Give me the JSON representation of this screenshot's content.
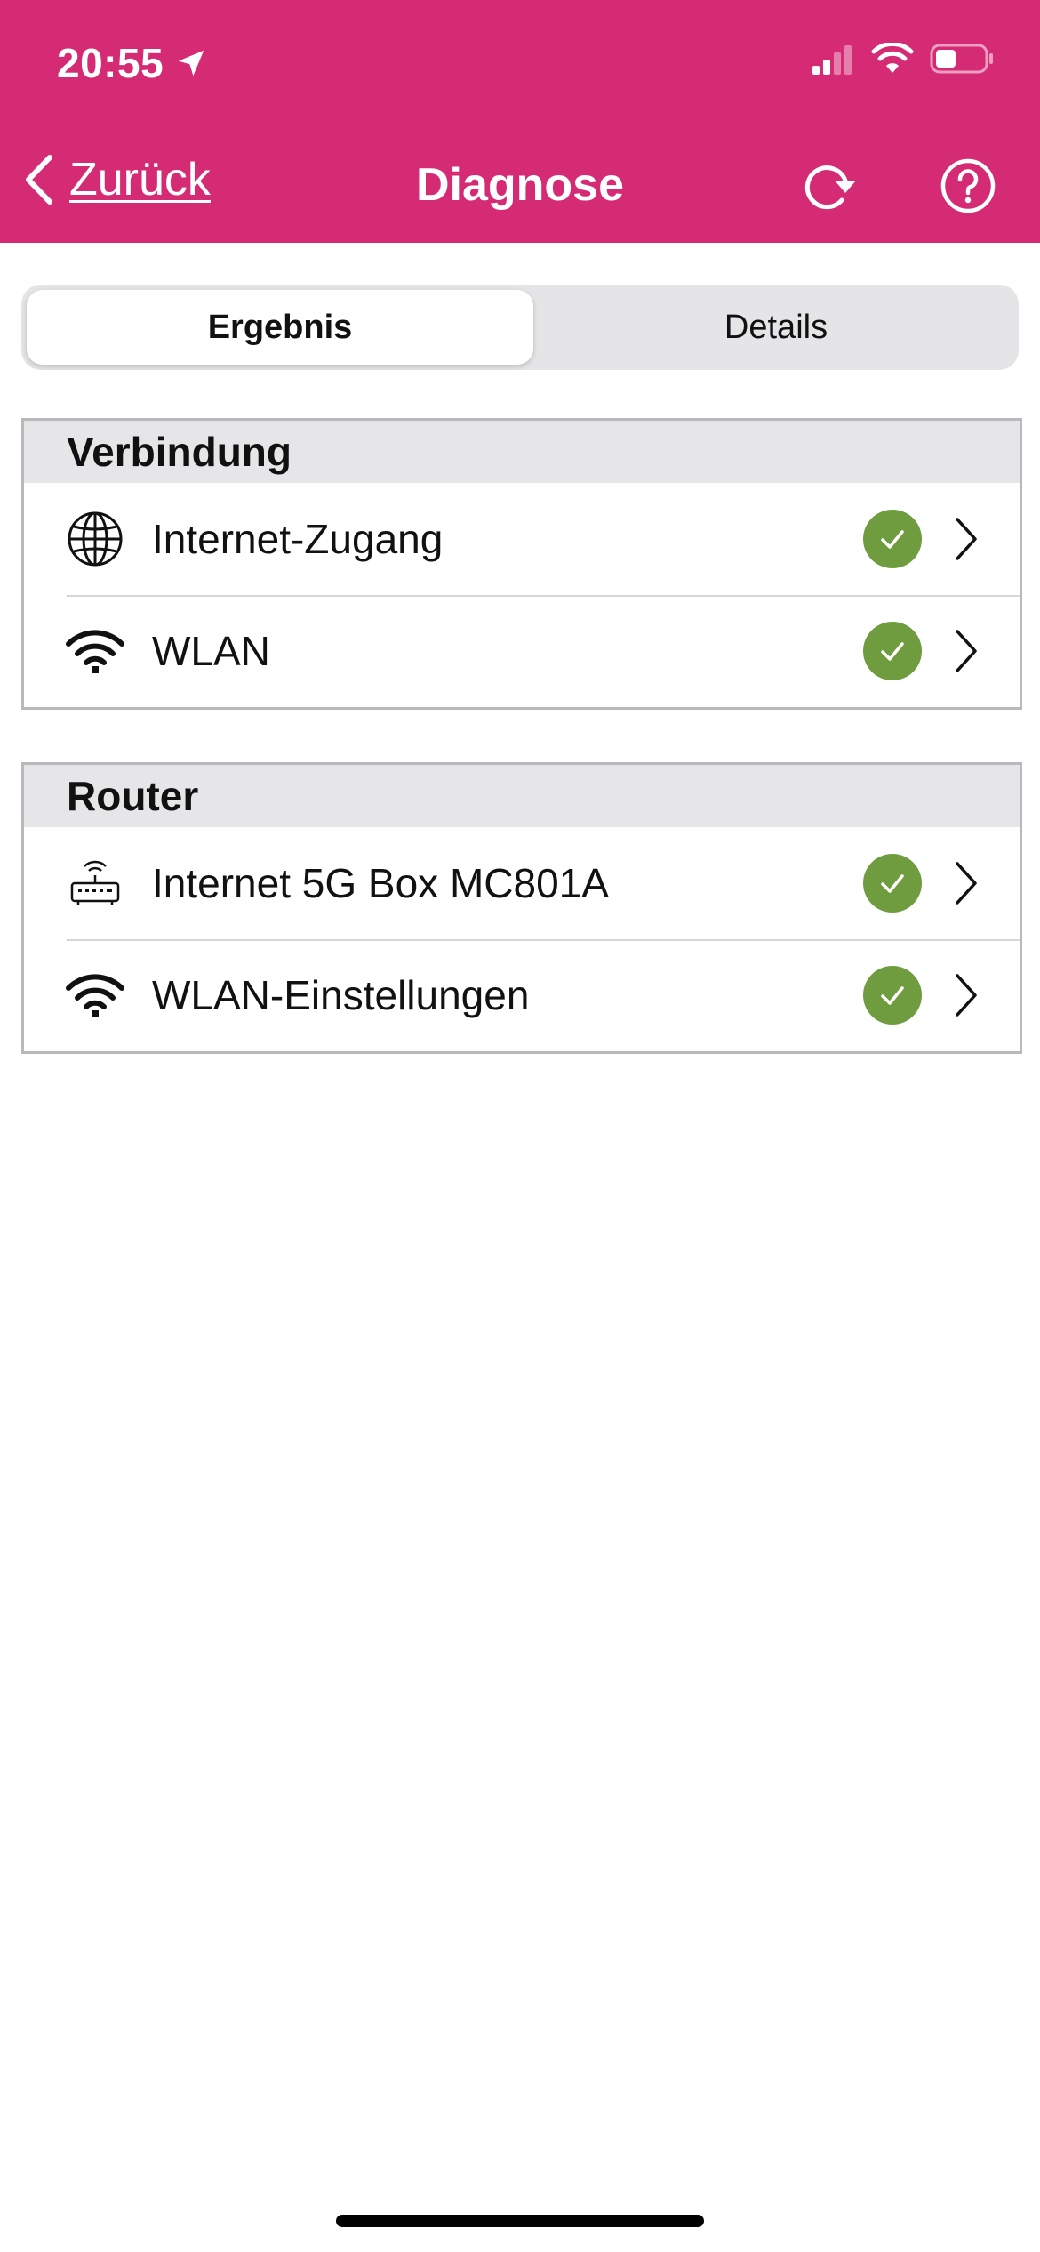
{
  "status_bar": {
    "time": "20:55",
    "location_icon": "location-arrow-icon",
    "signal_icon": "cellular-signal-icon",
    "wifi_icon": "wifi-icon",
    "battery_icon": "battery-icon"
  },
  "nav": {
    "back_label": "Zurück",
    "title": "Diagnose",
    "refresh_icon": "refresh-icon",
    "help_icon": "help-icon"
  },
  "tabs": [
    {
      "label": "Ergebnis",
      "selected": true
    },
    {
      "label": "Details",
      "selected": false
    }
  ],
  "sections": [
    {
      "title": "Verbindung",
      "items": [
        {
          "label": "Internet-Zugang",
          "icon": "globe-icon",
          "status": "ok"
        },
        {
          "label": "WLAN",
          "icon": "wifi-icon",
          "status": "ok"
        }
      ]
    },
    {
      "title": "Router",
      "items": [
        {
          "label": "Internet 5G Box MC801A",
          "icon": "router-icon",
          "status": "ok"
        },
        {
          "label": "WLAN-Einstellungen",
          "icon": "wifi-icon",
          "status": "ok"
        }
      ]
    }
  ],
  "colors": {
    "brand": "#d52b74",
    "status_ok": "#6f9c3e",
    "section_header_bg": "#e6e6e8"
  }
}
